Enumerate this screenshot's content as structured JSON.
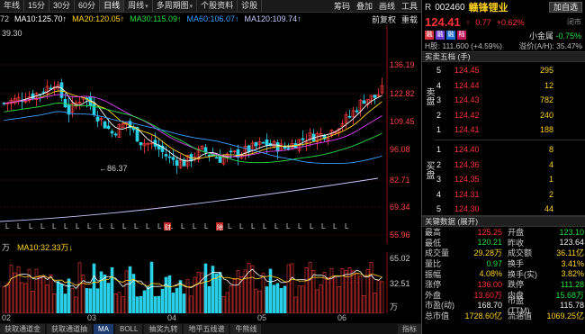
{
  "toolbar": {
    "items": [
      "年线",
      "15分",
      "30分",
      "60分",
      "日线",
      "周线",
      "多周期图",
      "个股资料",
      "诊股"
    ],
    "right": [
      "筹码",
      "叠加",
      "画线",
      "工具"
    ]
  },
  "ma_legend": {
    "prefix": "72",
    "items": [
      {
        "label": "MA10:125.70↑",
        "color": "#ffffff"
      },
      {
        "label": "MA20:120.05↑",
        "color": "#ffd21e"
      },
      {
        "label": "MA30:115.09↑",
        "color": "#22dd44"
      },
      {
        "label": "MA60:106.07↑",
        "color": "#3aa0ff"
      },
      {
        "label": "MA120:109.74↑",
        "color": "#c7c7ff"
      }
    ],
    "right": [
      "前复权",
      "重载"
    ]
  },
  "chart": {
    "price_labels": [
      "136.19",
      "122.82",
      "109.45",
      "96.08",
      "82.71",
      "69.34",
      "55.96"
    ],
    "top_left": "39.30",
    "low_marker": "←86.37",
    "event_markers": [
      "财",
      "除"
    ]
  },
  "volume": {
    "legend_unit": "万",
    "legend_ma": "MA10:32.33万↓",
    "axis_labels": [
      "65.02",
      "32.51",
      "万"
    ]
  },
  "xaxis": [
    "02",
    "03",
    "04",
    "05",
    "06"
  ],
  "bottom_tabs": [
    "获取通道金",
    "获取通道抽",
    "MA",
    "BOLL",
    "抽奖九转",
    "地平五线谱",
    "牛熊线",
    "指标"
  ],
  "stock": {
    "market": "R",
    "code": "002460",
    "name": "赣锋锂业",
    "add_button": "加自选",
    "price": "124.41",
    "arrow": "↑",
    "change": "0.77",
    "change_pct": "+0.62%",
    "closed": "闭市",
    "small_metal_label": "小金属",
    "small_metal_value": "-0.75%",
    "h_label": "H股: 111.600 (+4.59%)",
    "premium_label": "溢价(A/H): 35.47%"
  },
  "tags": [
    {
      "text": "融",
      "color": "#d6353b"
    },
    {
      "text": "融",
      "color": "#6e3bd1"
    },
    {
      "text": "融",
      "color": "#1a6ad1"
    },
    {
      "text": "陆",
      "color": "#c2185b"
    }
  ],
  "orderbook": {
    "title": "买卖五档 (手)",
    "sell_side": "卖盘",
    "buy_side": "买盘",
    "sell": [
      {
        "lv": "5",
        "price": "124.45",
        "qty": "295"
      },
      {
        "lv": "4",
        "price": "124.44",
        "qty": "12"
      },
      {
        "lv": "3",
        "price": "124.43",
        "qty": "782"
      },
      {
        "lv": "2",
        "price": "124.42",
        "qty": "240"
      },
      {
        "lv": "1",
        "price": "124.41",
        "qty": "188"
      }
    ],
    "buy": [
      {
        "lv": "1",
        "price": "124.40",
        "qty": "8"
      },
      {
        "lv": "2",
        "price": "124.36",
        "qty": "4"
      },
      {
        "lv": "3",
        "price": "124.35",
        "qty": "1"
      },
      {
        "lv": "4",
        "price": "124.31",
        "qty": "2"
      },
      {
        "lv": "5",
        "price": "124.30",
        "qty": "44"
      }
    ]
  },
  "stats": {
    "title": "关键数据 (展开)",
    "rows": [
      {
        "k": "最高",
        "v": "125.25",
        "vc": "red",
        "k2": "开盘",
        "v2": "123.10",
        "v2c": "green"
      },
      {
        "k": "最低",
        "v": "120.21",
        "vc": "green",
        "k2": "昨收",
        "v2": "123.64",
        "v2c": "white"
      },
      {
        "k": "成交量",
        "v": "29.28万",
        "vc": "yellow",
        "k2": "成交额",
        "v2": "36.11亿",
        "v2c": "yellow"
      },
      {
        "k": "量比",
        "v": "0.97",
        "vc": "green",
        "k2": "换手",
        "v2": "3.41%",
        "v2c": "yellow"
      },
      {
        "k": "振幅",
        "v": "4.08%",
        "vc": "yellow",
        "k2": "换手(实)",
        "v2": "3.82%",
        "v2c": "yellow"
      },
      {
        "k": "涨停",
        "v": "136.00",
        "vc": "red",
        "k2": "跌停",
        "v2": "111.28",
        "v2c": "green"
      },
      {
        "k": "外盘",
        "v": "13.60万",
        "vc": "red",
        "k2": "内盘",
        "v2": "15.68万",
        "v2c": "green"
      },
      {
        "k": "市盈(动)",
        "v": "168.70",
        "vc": "white",
        "k2": "市盈(TTM)",
        "v2": "115.78",
        "v2c": "white"
      },
      {
        "k": "总市值",
        "v": "1728.60亿",
        "vc": "yellow",
        "k2": "流通值",
        "v2": "1069.25亿",
        "v2c": "yellow"
      }
    ]
  }
}
